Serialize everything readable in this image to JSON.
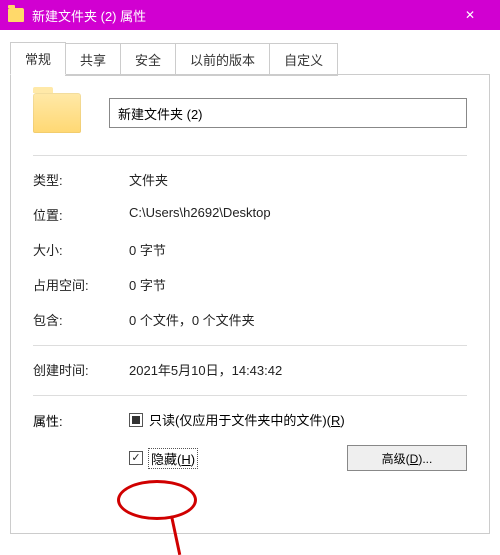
{
  "window": {
    "title": "新建文件夹 (2) 属性",
    "close_glyph": "✕"
  },
  "tabs": {
    "general": "常规",
    "sharing": "共享",
    "security": "安全",
    "previous": "以前的版本",
    "custom": "自定义"
  },
  "general": {
    "name_value": "新建文件夹 (2)",
    "type_label": "类型:",
    "type_value": "文件夹",
    "location_label": "位置:",
    "location_value": "C:\\Users\\h2692\\Desktop",
    "size_label": "大小:",
    "size_value": "0 字节",
    "size_on_disk_label": "占用空间:",
    "size_on_disk_value": "0 字节",
    "contains_label": "包含:",
    "contains_value": "0 个文件，0 个文件夹",
    "created_label": "创建时间:",
    "created_value": "2021年5月10日，14:43:42",
    "attributes_label": "属性:",
    "readonly_label_pre": "只读(仅应用于文件夹中的文件)(",
    "readonly_key": "R",
    "readonly_label_post": ")",
    "hidden_label_pre": "隐藏(",
    "hidden_key": "H",
    "hidden_label_post": ")",
    "advanced_label_pre": "高级(",
    "advanced_key": "D",
    "advanced_label_post": ")..."
  }
}
